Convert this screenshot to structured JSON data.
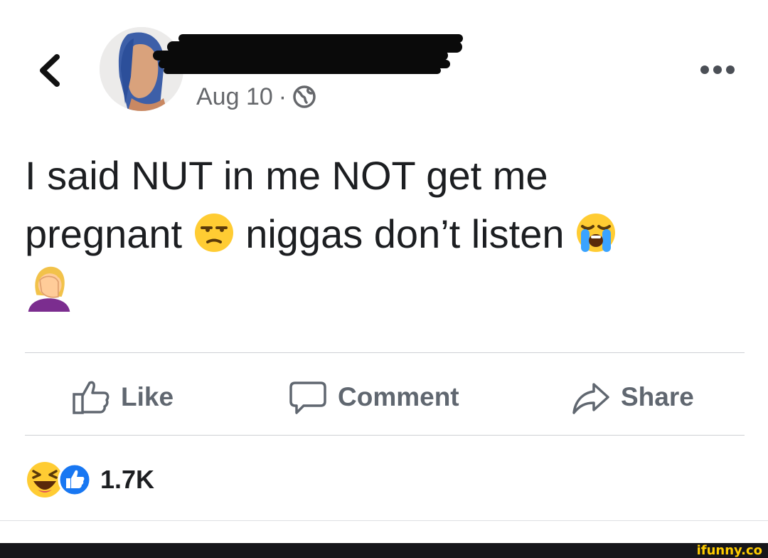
{
  "post": {
    "date": "Aug 10",
    "separator": "·",
    "audience_icon": "globe-icon",
    "text_line1": "I said NUT in me NOT get me",
    "text_line2_a": "pregnant",
    "text_line2_b": "niggas don’t listen",
    "emojis": [
      "unamused-face",
      "loudly-crying-face",
      "woman-facepalming"
    ]
  },
  "actions": {
    "like": "Like",
    "comment": "Comment",
    "share": "Share"
  },
  "reactions": {
    "types": [
      "haha",
      "like"
    ],
    "count": "1.7K"
  },
  "footer": {
    "watermark": "ifunny.co"
  },
  "colors": {
    "like_blue": "#1877f2",
    "text": "#1c1e21",
    "muted": "#65676b",
    "action_gray": "#606770",
    "emoji_yellow": "#ffcc33",
    "watermark_bar": "#16161a",
    "watermark_text": "#ffcc00"
  }
}
